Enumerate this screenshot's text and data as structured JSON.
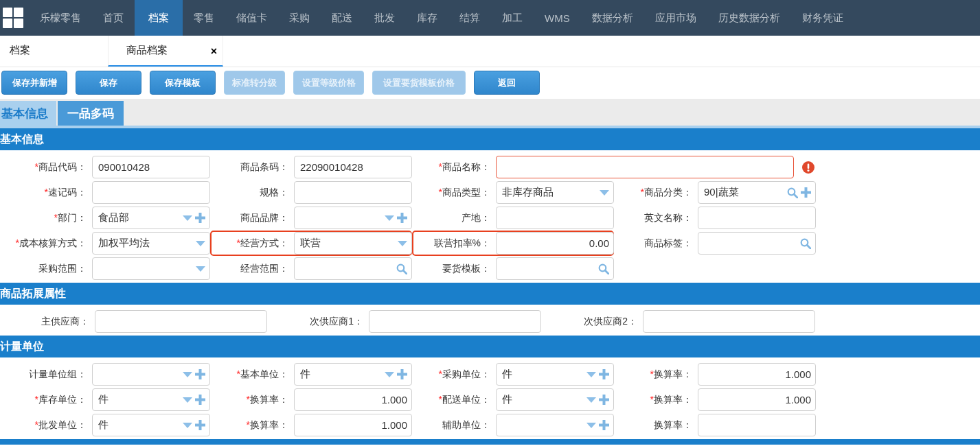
{
  "nav": {
    "items": [
      {
        "label": "乐檬零售",
        "selected": false
      },
      {
        "label": "首页",
        "selected": false
      },
      {
        "label": "档案",
        "selected": true
      },
      {
        "label": "零售",
        "selected": false
      },
      {
        "label": "储值卡",
        "selected": false
      },
      {
        "label": "采购",
        "selected": false
      },
      {
        "label": "配送",
        "selected": false
      },
      {
        "label": "批发",
        "selected": false
      },
      {
        "label": "库存",
        "selected": false
      },
      {
        "label": "结算",
        "selected": false
      },
      {
        "label": "加工",
        "selected": false
      },
      {
        "label": "WMS",
        "selected": false
      },
      {
        "label": "数据分析",
        "selected": false
      },
      {
        "label": "应用市场",
        "selected": false
      },
      {
        "label": "历史数据分析",
        "selected": false
      },
      {
        "label": "财务凭证",
        "selected": false
      }
    ]
  },
  "page_tabs": [
    {
      "label": "档案",
      "selected": false
    },
    {
      "label": "商品档案",
      "selected": true,
      "close": "×"
    }
  ],
  "toolbar": [
    {
      "label": "保存并新增",
      "disabled": false
    },
    {
      "label": "保存",
      "disabled": false
    },
    {
      "label": "保存模板",
      "disabled": false
    },
    {
      "label": "标准转分级",
      "disabled": true
    },
    {
      "label": "设置等级价格",
      "disabled": true
    },
    {
      "label": "设置要货模板价格",
      "disabled": true
    },
    {
      "label": "返回",
      "disabled": false
    }
  ],
  "form_tabs": [
    {
      "label": "基本信息",
      "selected": true
    },
    {
      "label": "一品多码",
      "selected": false
    }
  ],
  "sections": [
    {
      "title": "基本信息",
      "fields": [
        {
          "label": "商品代码：",
          "asterisk": "*",
          "kind": "text",
          "value": "090010428"
        },
        {
          "label": "商品条码：",
          "kind": "text",
          "value": "22090010428"
        },
        {
          "label": "商品名称：",
          "asterisk": "*",
          "kind": "text",
          "wide": true,
          "error": true
        },
        {
          "label": "速记码：",
          "asterisk": "*",
          "kind": "text"
        },
        {
          "label": "规格：",
          "kind": "text"
        },
        {
          "label": "商品类型：",
          "asterisk": "*",
          "kind": "select",
          "value": "非库存商品"
        },
        {
          "label": "商品分类：",
          "asterisk": "*",
          "kind": "search_add",
          "value": "90|蔬菜"
        },
        {
          "label": "部门：",
          "asterisk": "*",
          "kind": "select_add",
          "value": "食品部"
        },
        {
          "label": "商品品牌：",
          "kind": "select_add"
        },
        {
          "label": "产地：",
          "kind": "text"
        },
        {
          "label": "英文名称：",
          "kind": "text"
        },
        {
          "label": "成本核算方式：",
          "asterisk": "*",
          "kind": "select",
          "value": "加权平均法"
        },
        {
          "label": "经营方式：",
          "asterisk": "*",
          "kind": "select",
          "value": "联营",
          "highlighted": true
        },
        {
          "label": "联营扣率%：",
          "kind": "number",
          "value": "0.00",
          "highlighted": true
        },
        {
          "label": "商品标签：",
          "kind": "search"
        },
        {
          "label": "采购范围：",
          "kind": "select"
        },
        {
          "label": "经营范围：",
          "kind": "search"
        },
        {
          "label": "要货模板：",
          "kind": "search"
        }
      ]
    },
    {
      "title": "商品拓展属性",
      "fields": [
        {
          "label": "主供应商：",
          "kind": "text"
        },
        {
          "label": "次供应商1：",
          "kind": "text"
        },
        {
          "label": "次供应商2：",
          "kind": "text"
        }
      ]
    },
    {
      "title": "计量单位",
      "fields": [
        {
          "label": "计量单位组：",
          "kind": "select_add"
        },
        {
          "label": "基本单位：",
          "asterisk": "*",
          "kind": "select_add",
          "value": "件"
        },
        {
          "label": "采购单位：",
          "asterisk": "*",
          "kind": "select_add",
          "value": "件"
        },
        {
          "label": "换算率：",
          "asterisk": "*",
          "kind": "number",
          "value": "1.000"
        },
        {
          "label": "库存单位：",
          "asterisk": "*",
          "kind": "select_add",
          "value": "件"
        },
        {
          "label": "换算率：",
          "asterisk": "*",
          "kind": "number",
          "value": "1.000"
        },
        {
          "label": "配送单位：",
          "asterisk": "*",
          "kind": "select_add",
          "value": "件"
        },
        {
          "label": "换算率：",
          "asterisk": "*",
          "kind": "number",
          "value": "1.000"
        },
        {
          "label": "批发单位：",
          "asterisk": "*",
          "kind": "select_add",
          "value": "件"
        },
        {
          "label": "换算率：",
          "asterisk": "*",
          "kind": "number",
          "value": "1.000"
        },
        {
          "label": "辅助单位：",
          "kind": "select_add"
        },
        {
          "label": "换算率：",
          "kind": "number"
        }
      ]
    }
  ]
}
